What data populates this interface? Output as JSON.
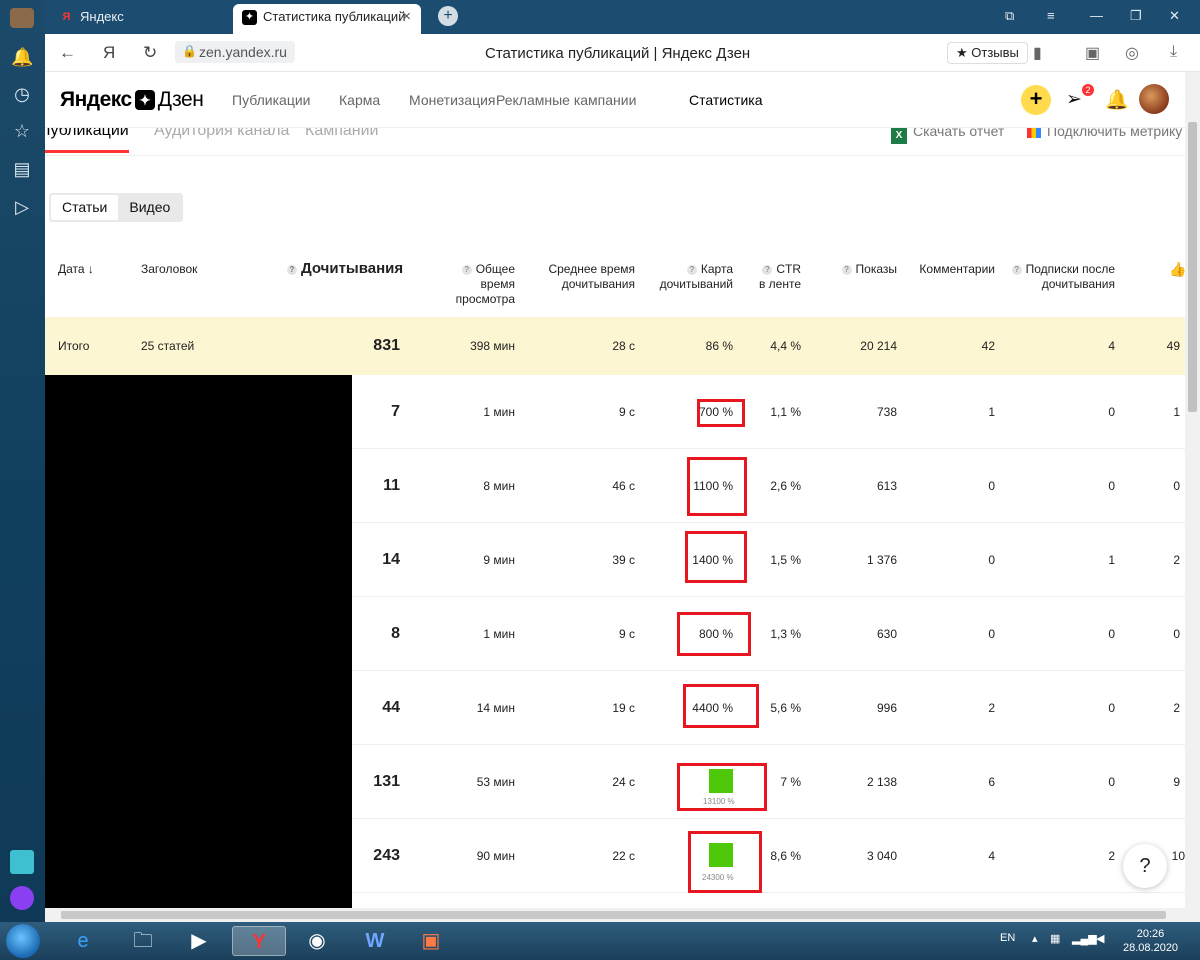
{
  "browser": {
    "tabs": [
      {
        "label": "Яндекс",
        "icon": "yandex-icon"
      },
      {
        "label": "Статистика публикаций",
        "icon": "dzen-icon",
        "active": true
      }
    ],
    "url": "zen.yandex.ru",
    "page_title": "Статистика публикаций | Яндекс Дзен",
    "reviews_label": "Отзывы"
  },
  "header": {
    "logo_bold": "Яндекс",
    "logo_rest": "Дзен",
    "nav": [
      "Публикации",
      "Карма",
      "Монетизация",
      "Рекламные кампании",
      "Статистика"
    ],
    "notification_count": "2"
  },
  "subtabs": {
    "items": [
      "Публикации",
      "Аудитория канала",
      "Кампании"
    ],
    "download": "Скачать отчет",
    "metrika": "Подключить метрику"
  },
  "segment": [
    "Статьи",
    "Видео"
  ],
  "table": {
    "headers": {
      "date": "Дата",
      "title": "Заголовок",
      "reads": "Дочитывания",
      "total_time": [
        "Общее время",
        "просмотра"
      ],
      "avg_time": [
        "Среднее время",
        "дочитывания"
      ],
      "read_map": [
        "Карта",
        "дочитываний"
      ],
      "ctr": [
        "CTR",
        "в ленте"
      ],
      "views": "Показы",
      "comments": "Комментарии",
      "subs": [
        "Подписки после",
        "дочитывания"
      ]
    },
    "total": {
      "label": "Итого",
      "title": "25 статей",
      "reads": "831",
      "total_time": "398 мин",
      "avg_time": "28 с",
      "read_map": "86 %",
      "ctr": "4,4 %",
      "views": "20 214",
      "comments": "42",
      "subs": "4",
      "likes": "49"
    },
    "rows": [
      {
        "reads": "7",
        "total_time": "1 мин",
        "avg_time": "9 с",
        "read_map": "700 %",
        "ctr": "1,1 %",
        "views": "738",
        "comments": "1",
        "subs": "0",
        "likes": "1"
      },
      {
        "reads": "11",
        "total_time": "8 мин",
        "avg_time": "46 с",
        "read_map": "1100 %",
        "ctr": "2,6 %",
        "views": "613",
        "comments": "0",
        "subs": "0",
        "likes": "0"
      },
      {
        "reads": "14",
        "total_time": "9 мин",
        "avg_time": "39 с",
        "read_map": "1400 %",
        "ctr": "1,5 %",
        "views": "1 376",
        "comments": "0",
        "subs": "1",
        "likes": "2"
      },
      {
        "reads": "8",
        "total_time": "1 мин",
        "avg_time": "9 с",
        "read_map": "800 %",
        "ctr": "1,3 %",
        "views": "630",
        "comments": "0",
        "subs": "0",
        "likes": "0"
      },
      {
        "reads": "44",
        "total_time": "14 мин",
        "avg_time": "19 с",
        "read_map": "4400 %",
        "ctr": "5,6 %",
        "views": "996",
        "comments": "2",
        "subs": "0",
        "likes": "2"
      },
      {
        "reads": "131",
        "total_time": "53 мин",
        "avg_time": "24 с",
        "read_map": "13100 %",
        "ctr": "7 %",
        "views": "2 138",
        "comments": "6",
        "subs": "0",
        "likes": "9"
      },
      {
        "reads": "243",
        "total_time": "90 мин",
        "avg_time": "22 с",
        "read_map": "24300 %",
        "ctr": "8,6 %",
        "views": "3 040",
        "comments": "4",
        "subs": "2",
        "likes": "10"
      }
    ]
  },
  "help_label": "?",
  "taskbar": {
    "lang": "EN",
    "time": "20:26",
    "date": "28.08.2020"
  },
  "colors": {
    "accent_red": "#e8161e",
    "total_row_bg": "#fdf6d3",
    "plus_button": "#ffdb4d",
    "map_green": "#4fc80a"
  }
}
